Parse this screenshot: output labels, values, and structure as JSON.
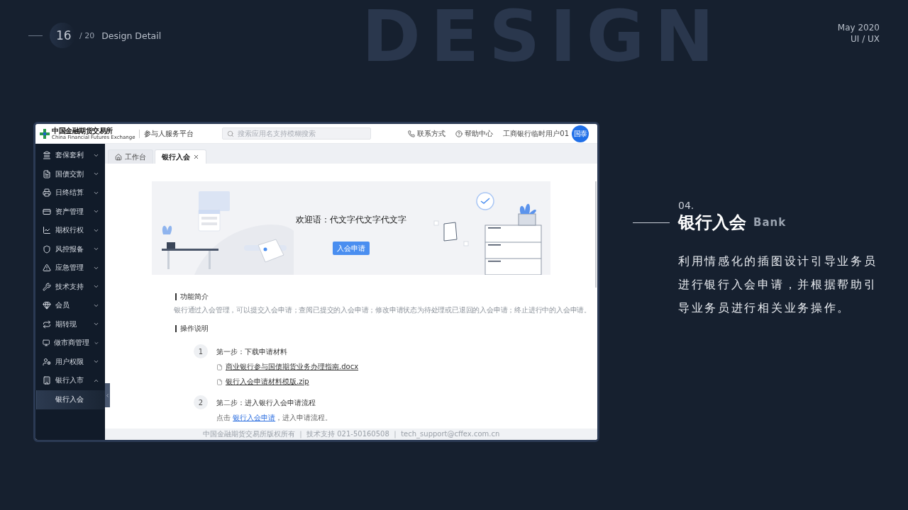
{
  "slide": {
    "page": "16",
    "total": "/ 20",
    "section": "Design Detail",
    "date": "May 2020",
    "category": "UI / UX",
    "backdrop_word": "DESIGN"
  },
  "app": {
    "logo": {
      "name": "中国金融期货交易所",
      "subtitle": "China Financial Futures Exchange"
    },
    "platform": "参与人服务平台",
    "search": {
      "placeholder": "搜索应用名支持模糊搜索"
    },
    "header_links": [
      {
        "kind": "phone",
        "label": "联系方式"
      },
      {
        "kind": "help",
        "label": "帮助中心"
      }
    ],
    "user": {
      "name": "工商银行临时用户01",
      "avatar": "国泰"
    },
    "sidebar": {
      "items": [
        {
          "label": "套保套利",
          "expanded": false
        },
        {
          "label": "国债交割",
          "expanded": false
        },
        {
          "label": "日终结算",
          "expanded": false
        },
        {
          "label": "资产管理",
          "expanded": false
        },
        {
          "label": "期权行权",
          "expanded": false
        },
        {
          "label": "风控报备",
          "expanded": false
        },
        {
          "label": "应急管理",
          "expanded": false
        },
        {
          "label": "技术支持",
          "expanded": false
        },
        {
          "label": "会员",
          "expanded": false
        },
        {
          "label": "期转现",
          "expanded": false
        },
        {
          "label": "做市商管理",
          "expanded": false
        },
        {
          "label": "用户权限",
          "expanded": false
        },
        {
          "label": "银行入市",
          "expanded": true,
          "children": [
            {
              "label": "银行入会",
              "selected": true
            }
          ]
        }
      ]
    },
    "tabs": [
      {
        "label": "工作台",
        "kind": "home",
        "selected": false
      },
      {
        "label": "银行入会",
        "kind": "closable",
        "selected": true
      }
    ],
    "banner": {
      "title": "欢迎语：代文字代文字代文字",
      "button": "入会申请"
    },
    "intro": {
      "heading": "功能简介",
      "text": "银行通过入会管理，可以提交入会申请；查阅已提交的入会申请；修改申请状态为待处理或已退回的入会申请；终止进行中的入会申请。"
    },
    "steps_heading": "操作说明",
    "steps": [
      {
        "number": "1",
        "title": "第一步：下载申请材料",
        "files": [
          "商业银行参与国债期货业务办理指南.docx",
          "银行入会申请材料模版.zip"
        ]
      },
      {
        "number": "2",
        "title": "第二步：进入银行入会申请流程",
        "note": {
          "before": "点击 ",
          "link": "银行入会申请",
          "after": "，进入申请流程。"
        }
      }
    ],
    "footer": "中国金融期货交易所版权所有 ｜ 技术支持 021-50160508 ｜ tech_support@cffex.com.cn"
  },
  "feature": {
    "number": "04.",
    "title": "银行入会",
    "subtitle": "Bank",
    "description": "利用情感化的插图设计引导业务员进行银行入会申请，并根据帮助引导业务员进行相关业务操作。"
  }
}
